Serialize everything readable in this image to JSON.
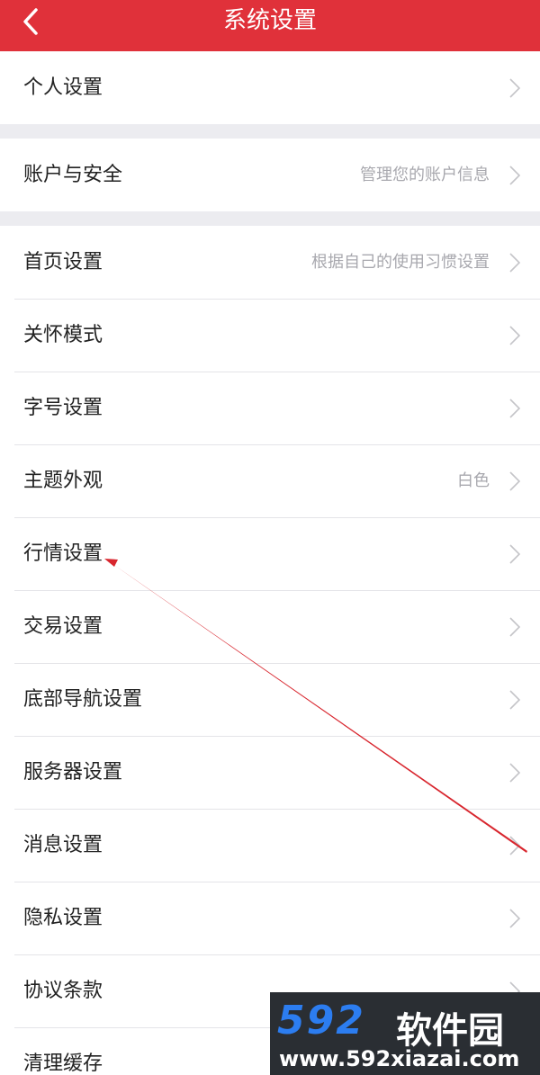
{
  "header": {
    "title": "系统设置",
    "back_icon": "chevron-left-icon",
    "background": "#e0313a"
  },
  "groups": [
    {
      "items": [
        {
          "label": "个人设置",
          "hint": ""
        }
      ]
    },
    {
      "items": [
        {
          "label": "账户与安全",
          "hint": "管理您的账户信息"
        }
      ]
    },
    {
      "items": [
        {
          "label": "首页设置",
          "hint": "根据自己的使用习惯设置"
        },
        {
          "label": "关怀模式",
          "hint": ""
        },
        {
          "label": "字号设置",
          "hint": ""
        },
        {
          "label": "主题外观",
          "hint": "白色"
        },
        {
          "label": "行情设置",
          "hint": ""
        },
        {
          "label": "交易设置",
          "hint": ""
        },
        {
          "label": "底部导航设置",
          "hint": ""
        },
        {
          "label": "服务器设置",
          "hint": ""
        },
        {
          "label": "消息设置",
          "hint": ""
        },
        {
          "label": "隐私设置",
          "hint": ""
        },
        {
          "label": "协议条款",
          "hint": ""
        },
        {
          "label": "清理缓存",
          "hint": ""
        }
      ]
    }
  ],
  "annotation": {
    "color": "#d8262e",
    "points_to": "行情设置"
  },
  "watermark": {
    "brand": "592",
    "brand_cn": "软件园",
    "url": "www.592xiazai.com"
  }
}
